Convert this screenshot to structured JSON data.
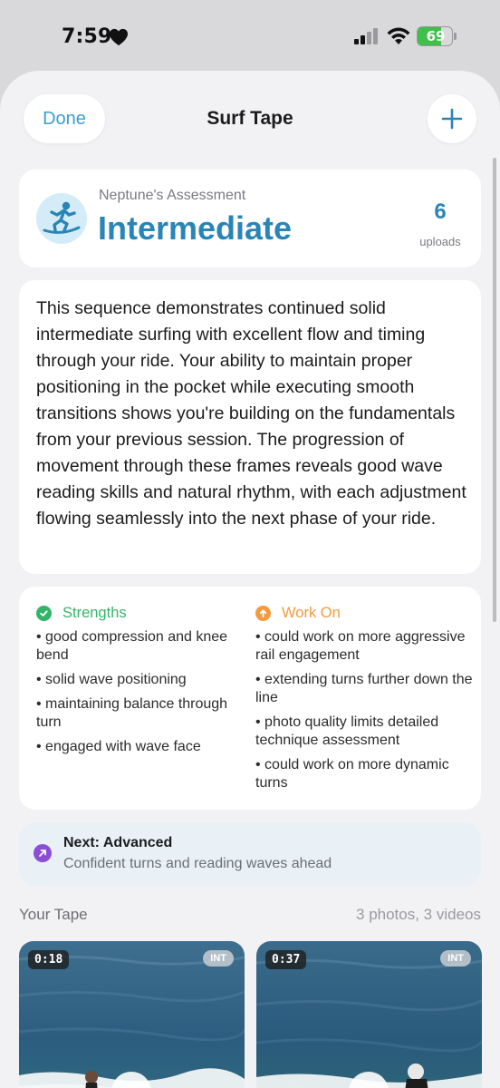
{
  "status_bar": {
    "time": "7:59",
    "battery_percent": 69,
    "battery_label": "69",
    "icons": [
      "heart-icon",
      "cellular-signal-icon",
      "wifi-icon",
      "battery-charging-icon"
    ]
  },
  "nav": {
    "done_label": "Done",
    "title": "Surf Tape",
    "add_icon": "plus-icon"
  },
  "assessment": {
    "icon": "surfer-icon",
    "label": "Neptune's Assessment",
    "level": "Intermediate",
    "uploads_count": "6",
    "uploads_label": "uploads"
  },
  "description": "This sequence demonstrates continued solid intermediate surfing with excellent flow and timing through your ride. Your ability to maintain proper positioning in the pocket while executing smooth transitions shows you're building on the fundamentals from your previous session. The progression of movement through these frames reveals good wave reading skills and natural rhythm, with each adjustment flowing seamlessly into the next phase of your ride.",
  "strengths": {
    "title": "Strengths",
    "icon": "checkmark-circle-icon",
    "items": [
      "• good compression and knee bend",
      "• solid wave positioning",
      "• maintaining balance through turn",
      "• engaged with wave face"
    ]
  },
  "work_on": {
    "title": "Work On",
    "icon": "arrow-up-circle-icon",
    "items": [
      "• could work on more aggressive rail engagement",
      "• extending turns further down the line",
      "• photo quality limits detailed technique assessment",
      "• could work on more dynamic turns"
    ]
  },
  "next": {
    "icon": "arrow-up-right-icon",
    "title": "Next: Advanced",
    "subtitle": "Confident turns and reading waves ahead"
  },
  "tape": {
    "title": "Your Tape",
    "count": "3 photos, 3 videos",
    "items": [
      {
        "duration": "0:18",
        "badge": "INT"
      },
      {
        "duration": "0:37",
        "badge": "INT"
      }
    ]
  },
  "colors": {
    "accent": "#2a85b7",
    "done_text": "#3a9fd0",
    "strengths": "#34b36a",
    "work_on": "#f39a3b",
    "next_icon": "#8b4ed3",
    "battery": "#3ec04a"
  }
}
